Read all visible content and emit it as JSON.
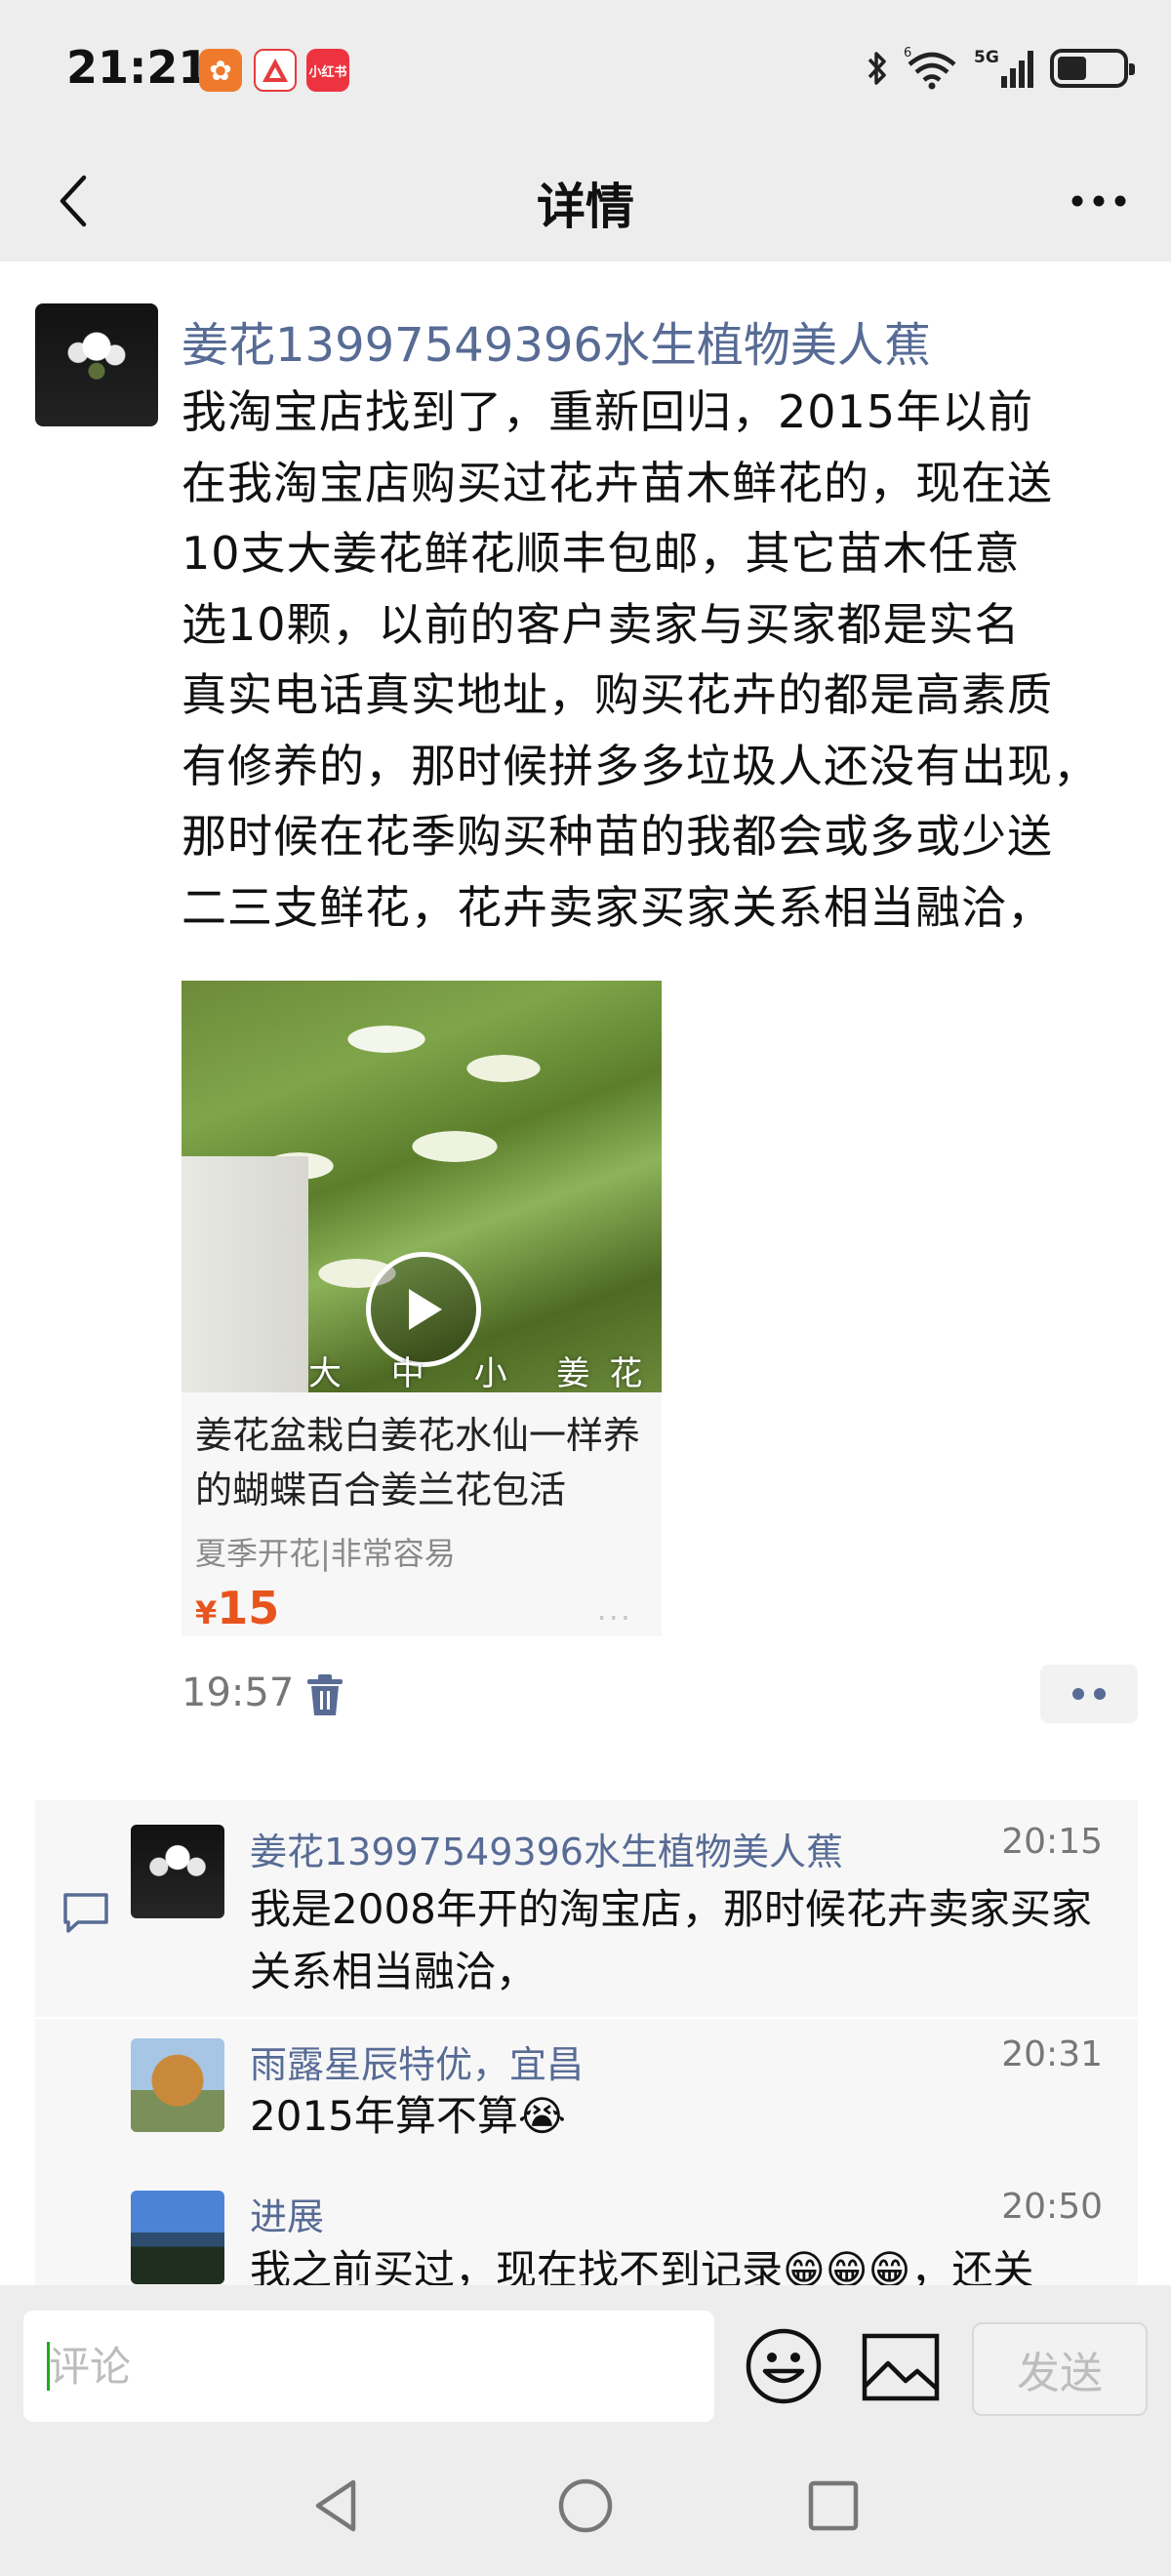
{
  "status_bar": {
    "time": "21:21",
    "app_icons": [
      {
        "name": "kuaishou-app-icon",
        "glyph": "✿"
      },
      {
        "name": "app-notification-icon",
        "glyph": "▲"
      },
      {
        "name": "xiaohongshu-app-icon",
        "glyph": "小红书"
      }
    ],
    "network": "5G",
    "wifi_badge": "6",
    "battery_level": 0.45
  },
  "header": {
    "title": "详情"
  },
  "post": {
    "author": "姜花13997549396水生植物美人蕉",
    "lines": [
      "我淘宝店找到了，重新回归，2015年以前",
      "在我淘宝店购买过花卉苗木鲜花的，现在送",
      "10支大姜花鲜花顺丰包邮，其它苗木任意",
      "选10颗，以前的客户卖家与买家都是实名",
      "真实电话真实地址，购买花卉的都是高素质",
      "有修养的，那时候拼多多垃圾人还没有出现，",
      "那时候在花季购买种苗的我都会或多或少送",
      "二三支鲜花，花卉卖家买家关系相当融洽，"
    ],
    "product": {
      "image_caption": "大 中 小 姜花对比",
      "title": "姜花盆栽白姜花水仙一样养的蝴蝶百合姜兰花包活",
      "tags": "夏季开花|非常容易",
      "currency": "¥",
      "price": "15",
      "more": "···"
    },
    "time": "19:57"
  },
  "comments": [
    {
      "name": "姜花13997549396水生植物美人蕉",
      "time": "20:15",
      "text": "我是2008年开的淘宝店，那时候花卉卖家买家关系相当融洽，"
    },
    {
      "name": "雨露星辰特优，宜昌",
      "time": "20:31",
      "text": "2015年算不算😭"
    },
    {
      "name": "进展",
      "time": "20:50",
      "text": "我之前买过，现在找不到记录😁😁😁，还关"
    }
  ],
  "input_bar": {
    "placeholder": "评论",
    "send_label": "发送"
  },
  "colors": {
    "link": "#576b95",
    "price": "#e8541e",
    "caret": "#1aad19",
    "background_gray": "#ededed"
  }
}
